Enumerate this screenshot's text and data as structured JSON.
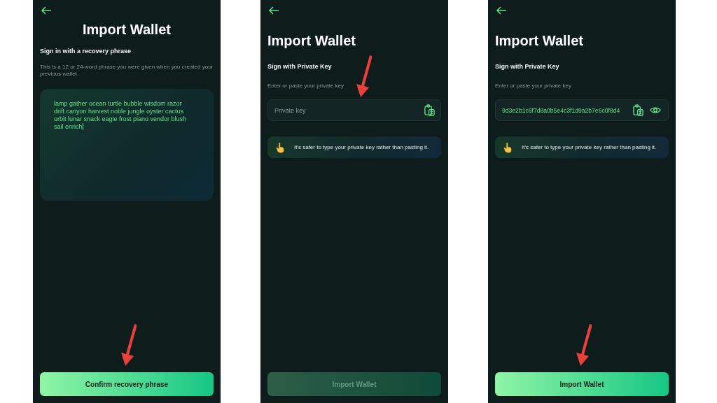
{
  "screens": [
    {
      "kind": "recovery",
      "title": "Import Wallet",
      "subtitle": "Sign in with a recovery phrase",
      "description": "This is a 12 or 24-word phrase you were given when you created your previous wallet.",
      "phrase": {
        "value": "lamp gather ocean turtle bubble wisdom razor drift canyon harvest noble jungle oyster cactus orbit lunar snack eagle frost piano vendor blush sail enrich",
        "focused": true
      },
      "button": {
        "label": "Confirm recovery phrase",
        "disabled": false
      },
      "arrow_on_button": true,
      "arrow_on_field": false
    },
    {
      "kind": "private_key",
      "title": "Import Wallet",
      "subtitle": "Sign with Private Key",
      "description": "Enter or paste your private key",
      "field": {
        "placeholder": "Private key"
      },
      "tip": "It's safer to type your private key rather than pasting it.",
      "button": {
        "label": "Import Wallet",
        "disabled": true
      },
      "arrow_on_button": false,
      "arrow_on_field": true
    },
    {
      "kind": "private_key",
      "title": "Import Wallet",
      "subtitle": "Sign with Private Key",
      "description": "Enter or paste your private key",
      "field": {
        "value": "9d3e2b1c6f7d8a0b5e4c3f1d9a2b7e6c0f8d4"
      },
      "tip": "It's safer to type your private key rather than pasting it.",
      "button": {
        "label": "Import Wallet",
        "disabled": false
      },
      "arrow_on_button": true,
      "arrow_on_field": false
    }
  ]
}
